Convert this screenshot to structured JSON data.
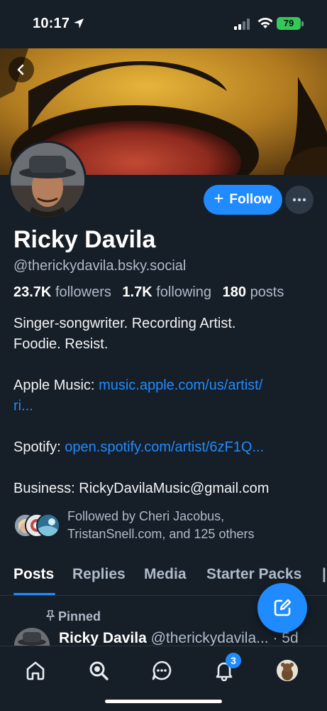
{
  "status_bar": {
    "time": "10:17",
    "battery": "79"
  },
  "profile": {
    "display_name": "Ricky Davila",
    "handle": "@therickydavila.bsky.social",
    "followers_count": "23.7K",
    "followers_label": "followers",
    "following_count": "1.7K",
    "following_label": "following",
    "posts_count": "180",
    "posts_label": "posts",
    "follow_label": "Follow",
    "bio_line1": "Singer-songwriter. Recording Artist.",
    "bio_line2": "Foodie. Resist.",
    "apple_prefix": "Apple Music: ",
    "apple_link_1": "music.apple.com/us/artist/",
    "apple_link_2": "ri...",
    "spotify_prefix": "Spotify: ",
    "spotify_link": "open.spotify.com/artist/6zF1Q...",
    "business_line": "Business: RickyDavilaMusic@gmail.com",
    "followed_by_line1": "Followed by Cheri Jacobus,",
    "followed_by_line2": "TristanSnell.com, and 125 others"
  },
  "tabs": [
    "Posts",
    "Replies",
    "Media",
    "Starter Packs"
  ],
  "active_tab": "Posts",
  "pinned_post": {
    "pinned_label": "Pinned",
    "author_name": "Ricky Davila",
    "author_handle": "@therickydavila...",
    "time": "· 5d"
  },
  "nav": {
    "notifications_badge": "3"
  },
  "colors": {
    "background": "#161e27",
    "accent": "#208bfe",
    "muted_text": "#aebbc9",
    "battery": "#34c759"
  },
  "icons": [
    "back-arrow-icon",
    "more-dots-icon",
    "plus-icon",
    "pin-icon",
    "compose-icon",
    "home-icon",
    "search-icon",
    "chat-icon",
    "bell-icon"
  ]
}
